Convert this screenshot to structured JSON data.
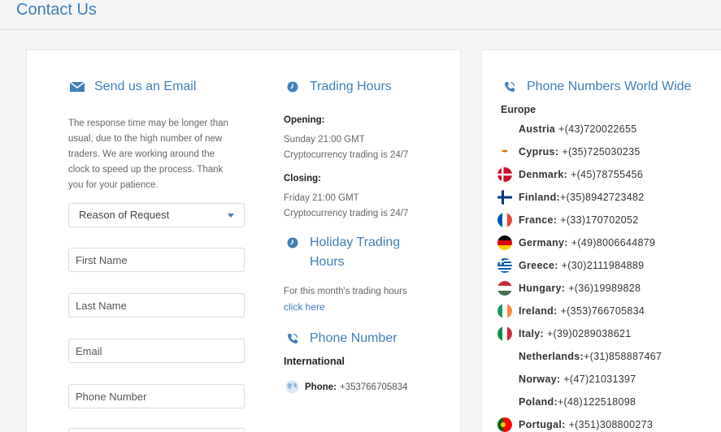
{
  "page": {
    "title": "Contact Us"
  },
  "email_section": {
    "title": "Send us an Email",
    "description_lines": [
      "The response time may be longer than",
      "usual, due to the high number of new",
      "traders. We are working around the",
      "clock to speed up the process. Thank",
      "you for your patience."
    ],
    "reason_select": "Reason of Request",
    "first_name_placeholder": "First Name",
    "last_name_placeholder": "Last Name",
    "email_placeholder": "Email",
    "phone_placeholder": "Phone Number"
  },
  "trading_hours": {
    "title": "Trading Hours",
    "opening_label": "Opening:",
    "opening_time": "Sunday 21:00 GMT",
    "opening_note": "Cryptocurrency trading is 24/7",
    "closing_label": "Closing:",
    "closing_time": "Friday 21:00 GMT",
    "closing_note": "Cryptocurrency trading is 24/7"
  },
  "holiday_hours": {
    "title_line1": "Holiday Trading",
    "title_line2": "Hours",
    "text": "For this month's trading hours",
    "link": "click here"
  },
  "phone_number": {
    "title": "Phone Number",
    "region": "International",
    "label": "Phone:",
    "value": "+353766705834"
  },
  "world_phones": {
    "title": "Phone Numbers World Wide",
    "region": "Europe",
    "entries": [
      {
        "country": "Austria",
        "sep": " ",
        "number": "+(43)720022655",
        "flag": "none"
      },
      {
        "country": "Cyprus:",
        "sep": " ",
        "number": "+(35)725030235",
        "flag": "cyprus"
      },
      {
        "country": "Denmark:",
        "sep": " ",
        "number": "+(45)78755456",
        "flag": "denmark"
      },
      {
        "country": "Finland:",
        "sep": "",
        "number": "+(35)8942723482",
        "flag": "finland"
      },
      {
        "country": "France:",
        "sep": " ",
        "number": "+(33)170702052",
        "flag": "france"
      },
      {
        "country": "Germany:",
        "sep": " ",
        "number": "+(49)8006644879",
        "flag": "germany"
      },
      {
        "country": "Greece:",
        "sep": " ",
        "number": "+(30)2111984889",
        "flag": "greece"
      },
      {
        "country": "Hungary:",
        "sep": " ",
        "number": "+(36)19989828",
        "flag": "hungary"
      },
      {
        "country": "Ireland:",
        "sep": " ",
        "number": "+(353)766705834",
        "flag": "ireland"
      },
      {
        "country": "Italy:",
        "sep": " ",
        "number": "+(39)0289038621",
        "flag": "italy"
      },
      {
        "country": "Netherlands:",
        "sep": "",
        "number": "+(31)858887467",
        "flag": "none"
      },
      {
        "country": "Norway:",
        "sep": " ",
        "number": "+(47)21031397",
        "flag": "none"
      },
      {
        "country": "Poland:",
        "sep": "",
        "number": "+(48)122518098",
        "flag": "none"
      },
      {
        "country": "Portugal:",
        "sep": " ",
        "number": "+(351)308800273",
        "flag": "portugal"
      }
    ]
  },
  "colors": {
    "accent": "#3f7fb8",
    "text": "#333333",
    "muted": "#666666"
  }
}
